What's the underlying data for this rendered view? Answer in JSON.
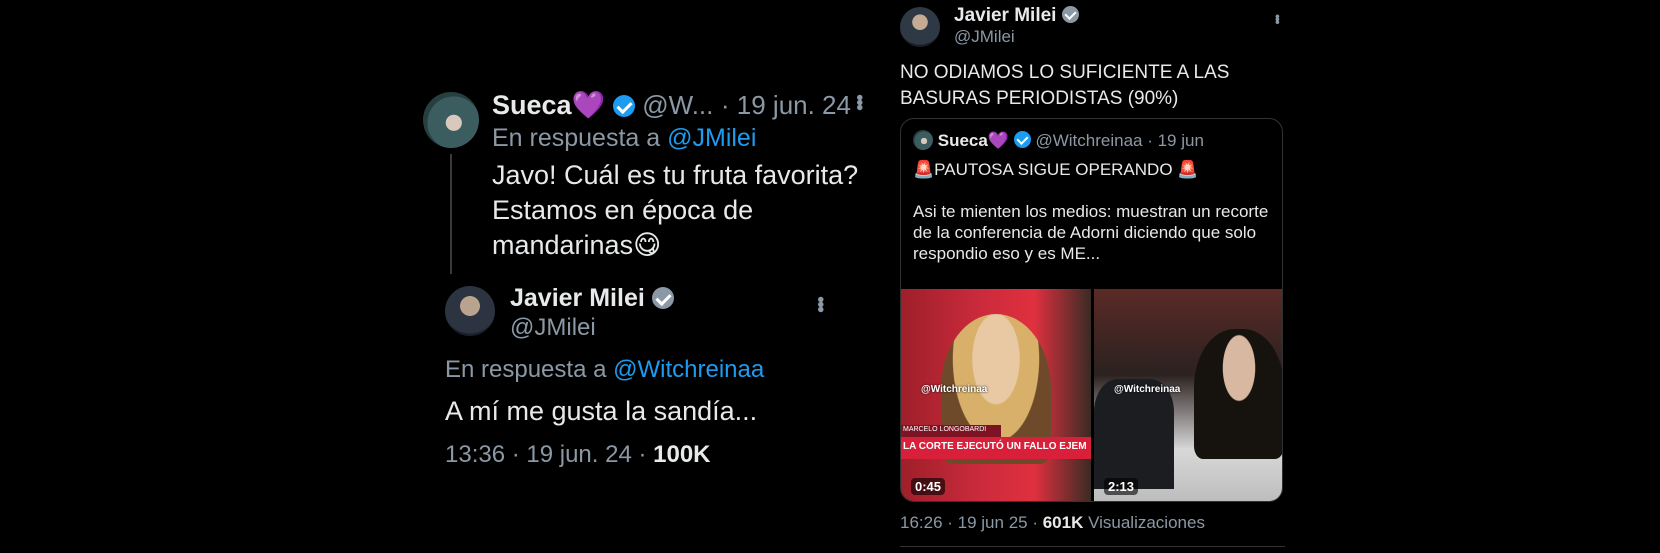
{
  "left_tweet": {
    "parent": {
      "name": "Sueca💜",
      "handle": "@W...",
      "date": "· 19 jun. 24",
      "reply_prefix": "En respuesta a",
      "reply_to": "@JMilei",
      "text": "Javo! Cuál es tu fruta favorita? Estamos en época de mandarinas😋"
    },
    "reply": {
      "name": "Javier Milei",
      "handle": "@JMilei",
      "reply_prefix": "En respuesta a",
      "reply_to": "@Witchreinaa",
      "text": "A mí me gusta la sandía...",
      "meta_time": "13:36 · 19 jun. 24 · ",
      "meta_views": "100K"
    }
  },
  "right_tweet": {
    "name": "Javier Milei",
    "handle": "@JMilei",
    "text": "NO ODIAMOS LO SUFICIENTE A LAS BASURAS PERIODISTAS (90%)",
    "quote": {
      "name": "Sueca💜",
      "handle": "@Witchreinaa · 19 jun",
      "line1": "PAUTOSA SIGUE OPERANDO",
      "body": "Asi te mienten los medios: muestran un recorte de la conferencia de Adorni diciendo que solo respondio eso y es ME...",
      "videos": [
        {
          "watermark": "@Witchreinaa",
          "lower_third_name": "MARCELO LONGOBARDI",
          "lower_third": "LA CORTE EJECUTÓ UN FALLO EJEM",
          "duration": "0:45"
        },
        {
          "watermark": "@Witchreinaa",
          "duration": "2:13"
        }
      ]
    },
    "meta_time": "16:26 · 19 jun 25 · ",
    "meta_views": "601K",
    "meta_views_label": " Visualizaciones"
  },
  "colors": {
    "background": "#000000",
    "text": "#e7e9ea",
    "muted": "#8b98a5",
    "link": "#1d9bf0",
    "verified": "#1d9bf0"
  }
}
